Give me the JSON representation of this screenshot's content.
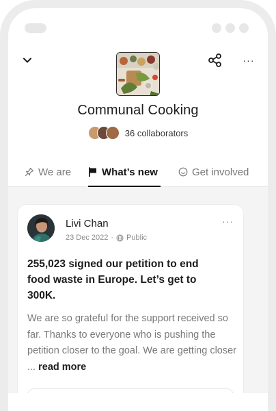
{
  "community": {
    "title": "Communal Cooking",
    "collaborators_label": "36 collaborators"
  },
  "header": {
    "back_icon": "chevron-down-icon",
    "share_icon": "share-icon",
    "more_icon": "more-horizontal-icon",
    "more_label": "···"
  },
  "tabs": [
    {
      "label": "We are",
      "icon": "pin-icon",
      "active": false
    },
    {
      "label": "What’s new",
      "icon": "flag-icon",
      "active": true
    },
    {
      "label": "Get involved",
      "icon": "smile-icon",
      "active": false
    }
  ],
  "post": {
    "author": "Livi Chan",
    "date": "23 Dec 2022",
    "separator": "·",
    "visibility": "Public",
    "more_label": "···",
    "headline": "255,023 signed our petition to end food waste in Europe. Let’s get to 300K.",
    "body": "We are so grateful for the support received so far. Thanks to everyone who is pushing the petition closer to the goal. We are getting closer ... ",
    "read_more": "read more"
  },
  "colors": {
    "accent": "#151515",
    "muted": "#777777",
    "feed_bg": "#f4f4f4",
    "bezel": "#ececec"
  }
}
